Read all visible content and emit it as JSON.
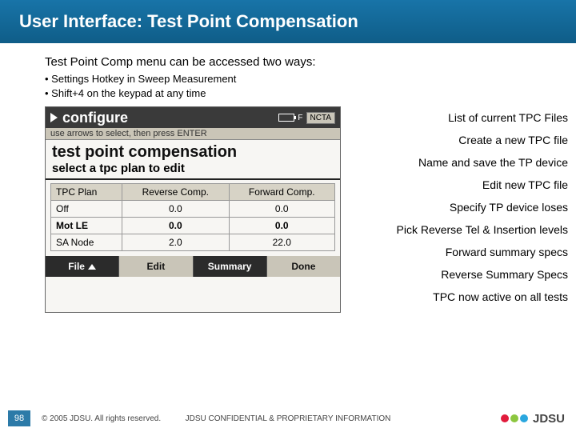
{
  "title": "User Interface:  Test Point Compensation",
  "intro_line": "Test Point Comp menu can be accessed two ways:",
  "bullets": [
    "Settings Hotkey in Sweep Measurement",
    "Shift+4 on the keypad at any time"
  ],
  "device": {
    "top_label": "configure",
    "batt_label": "F",
    "top_right": "NCTA",
    "hint": "use arrows to select, then press ENTER",
    "h1": "test point compensation",
    "h2": "select a tpc plan to edit",
    "cols": [
      "TPC Plan",
      "Reverse Comp.",
      "Forward Comp."
    ],
    "rows": [
      {
        "plan": "Off",
        "rev": "0.0",
        "fwd": "0.0",
        "sel": false
      },
      {
        "plan": "Mot LE",
        "rev": "0.0",
        "fwd": "0.0",
        "sel": true
      },
      {
        "plan": "SA Node",
        "rev": "2.0",
        "fwd": "22.0",
        "sel": false
      }
    ],
    "softkeys": [
      "File",
      "Edit",
      "Summary",
      "Done"
    ]
  },
  "annotations": [
    "List of current TPC Files",
    "Create a new TPC file",
    "Name and save the TP device",
    "Edit new TPC file",
    "Specify TP device loses",
    "Pick Reverse Tel & Insertion levels",
    "Forward summary specs",
    "Reverse Summary Specs",
    "TPC now active on all tests"
  ],
  "footer": {
    "page": "98",
    "copyright": "© 2005 JDSU. All rights reserved.",
    "confidential": "JDSU CONFIDENTIAL & PROPRIETARY INFORMATION",
    "brand": "JDSU"
  },
  "logo_colors": [
    "#e11b3c",
    "#8cc63f",
    "#2aa7df"
  ]
}
